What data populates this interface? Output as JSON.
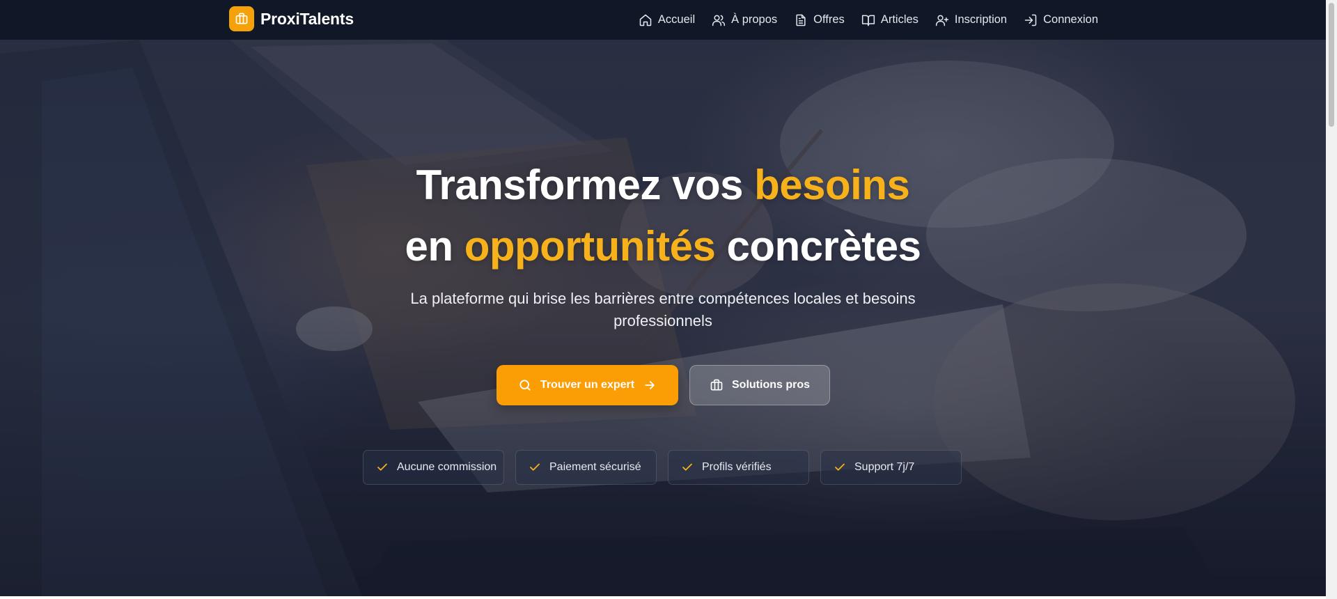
{
  "brand": {
    "name": "ProxiTalents",
    "logo_icon": "briefcase-icon",
    "accent_color": "#f5a20a"
  },
  "nav": {
    "items": [
      {
        "label": "Accueil",
        "icon": "home-icon"
      },
      {
        "label": "À propos",
        "icon": "users-icon"
      },
      {
        "label": "Offres",
        "icon": "document-icon"
      },
      {
        "label": "Articles",
        "icon": "book-open-icon"
      },
      {
        "label": "Inscription",
        "icon": "user-plus-icon"
      },
      {
        "label": "Connexion",
        "icon": "login-icon"
      }
    ]
  },
  "hero": {
    "headline": {
      "line1_a": "Transformez vos ",
      "line1_accent": "besoins",
      "line2_a": "en ",
      "line2_accent": "opportunités",
      "line2_b": " concrètes"
    },
    "subtitle": "La plateforme qui brise les barrières entre compétences locales et besoins professionnels",
    "primary_button": {
      "label": "Trouver un expert",
      "icon_left": "search-icon",
      "icon_right": "arrow-right-icon"
    },
    "secondary_button": {
      "label": "Solutions pros",
      "icon_left": "briefcase-icon"
    },
    "features": [
      {
        "label": "Aucune commission",
        "icon": "check-icon"
      },
      {
        "label": "Paiement sécurisé",
        "icon": "check-icon"
      },
      {
        "label": "Profils vérifiés",
        "icon": "check-icon"
      },
      {
        "label": "Support 7j/7",
        "icon": "check-icon"
      }
    ],
    "accent_color": "#f7b21b",
    "primary_color": "#fb9d05"
  }
}
